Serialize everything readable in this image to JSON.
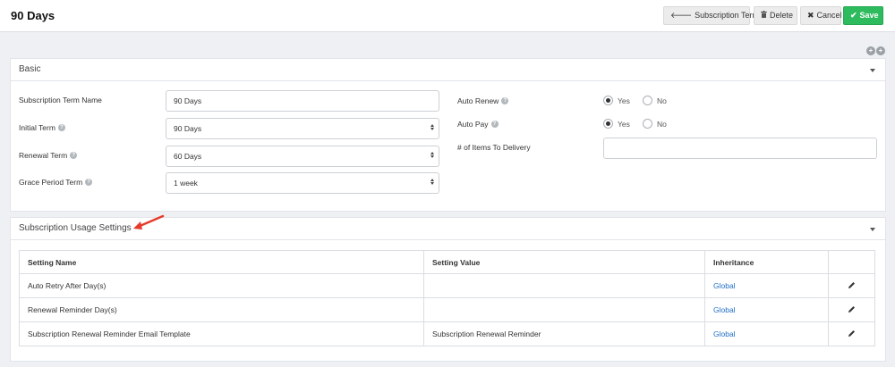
{
  "header": {
    "title": "90 Days",
    "buttons": {
      "subscription_terms": "Subscription Terms",
      "delete": "Delete",
      "cancel": "Cancel",
      "save": "Save"
    }
  },
  "basic": {
    "title": "Basic",
    "fields": {
      "term_name": {
        "label": "Subscription Term Name",
        "value": "90 Days"
      },
      "initial_term": {
        "label": "Initial Term",
        "value": "90 Days"
      },
      "renewal_term": {
        "label": "Renewal Term",
        "value": "60 Days"
      },
      "grace_period": {
        "label": "Grace Period Term",
        "value": "1 week"
      },
      "auto_renew": {
        "label": "Auto Renew",
        "yes": "Yes",
        "no": "No",
        "selected": "Yes"
      },
      "auto_pay": {
        "label": "Auto Pay",
        "yes": "Yes",
        "no": "No",
        "selected": "Yes"
      },
      "items_to_delivery": {
        "label": "# of Items To Delivery",
        "value": ""
      }
    }
  },
  "usage": {
    "title": "Subscription Usage Settings",
    "columns": [
      "Setting Name",
      "Setting Value",
      "Inheritance",
      ""
    ],
    "rows": [
      {
        "name": "Auto Retry After Day(s)",
        "value": "",
        "inheritance": "Global"
      },
      {
        "name": "Renewal Reminder Day(s)",
        "value": "",
        "inheritance": "Global"
      },
      {
        "name": "Subscription Renewal Reminder Email Template",
        "value": "Subscription Renewal Reminder",
        "inheritance": "Global"
      }
    ]
  },
  "colors": {
    "save": "#2dbb5d",
    "link": "#1f6fc5",
    "annotation_arrow": "#e53b2c"
  },
  "icons": {
    "subscription_terms": "arrow-left-icon",
    "delete": "trash-icon",
    "cancel": "close-icon",
    "save": "check-icon",
    "help": "question-circle-icon",
    "edit": "pencil-icon"
  }
}
